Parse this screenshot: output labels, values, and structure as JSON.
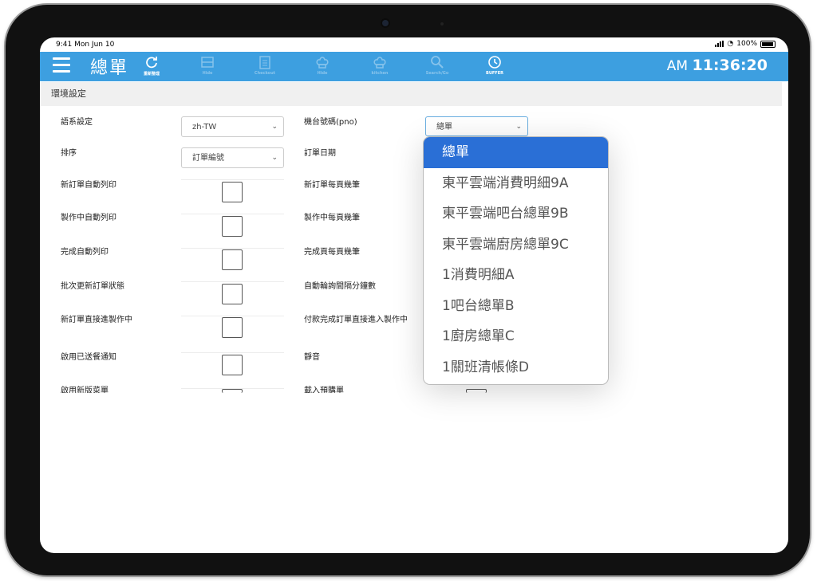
{
  "status_bar": {
    "time": "9:41",
    "date": "Mon Jun 10",
    "battery": "100%"
  },
  "navbar": {
    "title": "總單",
    "items": [
      {
        "label": "重新整理",
        "icon": "refresh-icon"
      },
      {
        "label": "Hide",
        "icon": "bag-icon"
      },
      {
        "label": "Checkout",
        "icon": "clipboard-icon"
      },
      {
        "label": "Hide",
        "icon": "chef-hat-icon"
      },
      {
        "label": "kitchen",
        "icon": "chef-hat-icon"
      },
      {
        "label": "Search/Go",
        "icon": "search-icon"
      },
      {
        "label": "BUFFER",
        "icon": "clock-icon"
      }
    ],
    "clock_period": "AM",
    "clock_time": "11:36:20",
    "color": "#3d9fe0"
  },
  "section_title": "環境設定",
  "settings": {
    "language_label": "語系設定",
    "language_value": "zh-TW",
    "sort_label": "排序",
    "sort_value": "訂單編號",
    "auto_print_new": "新訂單自動列印",
    "auto_print_making": "製作中自動列印",
    "auto_print_done": "完成自動列印",
    "batch_update": "批次更新訂單狀態",
    "new_to_making": "新訂單直接進製作中",
    "delivered_notify": "啟用已送餐通知",
    "new_menu": "啟用新版菜單",
    "machine_label": "機台號碼(pno)",
    "machine_value": "總單",
    "order_date": "訂單日期",
    "new_per_page": "新訂單每頁幾筆",
    "making_per_page": "製作中每頁幾筆",
    "done_per_page": "完成頁每頁幾筆",
    "poll_interval": "自動輪詢間隔分鐘數",
    "paid_to_making": "付款完成訂單直接進入製作中",
    "mute": "靜音",
    "load_preset": "載入預購單"
  },
  "dropdown": {
    "options": [
      "總單",
      "東平雲端消費明細9A",
      "東平雲端吧台總單9B",
      "東平雲端廚房總單9C",
      "1消費明細A",
      "1吧台總單B",
      "1廚房總單C",
      "1關班清帳條D"
    ],
    "selected_index": 0,
    "selected_color": "#2a6fd6"
  }
}
